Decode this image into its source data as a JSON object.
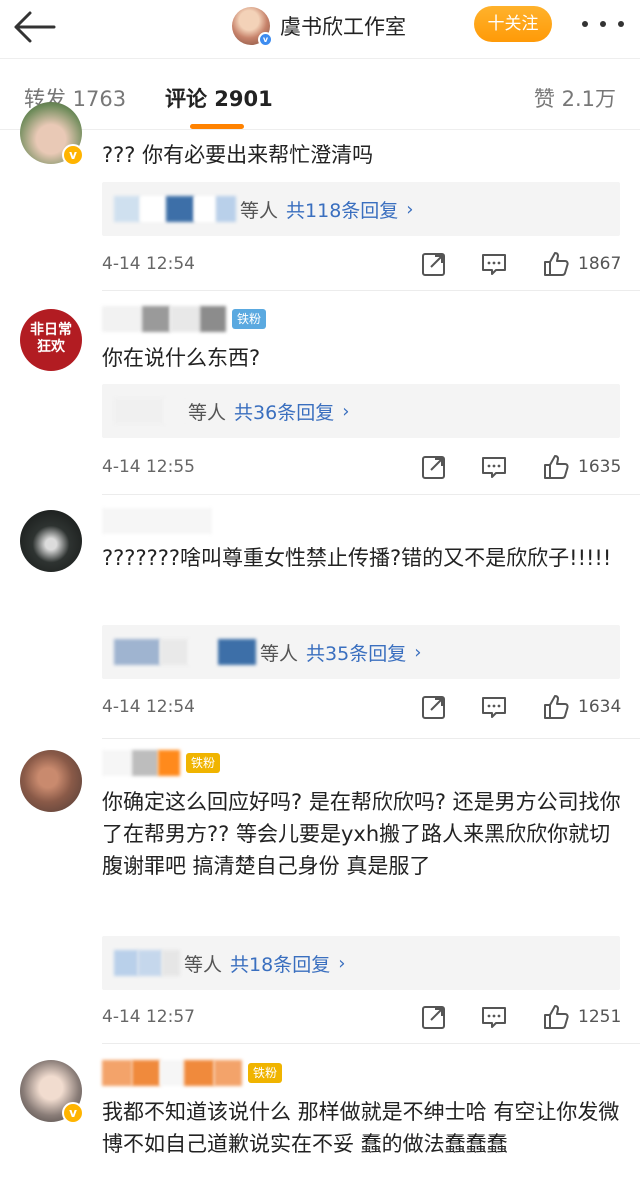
{
  "header": {
    "back_icon": "arrow-left-icon",
    "title": "虞书欣工作室",
    "follow_label": "十关注",
    "more_icon": "more-dots-icon",
    "accent": "#ff9a08"
  },
  "tabs": {
    "repost": "转发 1763",
    "comment": "评论 2901",
    "like": "赞 2.1万"
  },
  "comments": [
    {
      "text": "??? 你有必要出来帮忙澄清吗",
      "reply_who": "等人",
      "reply_count": "共118条回复",
      "chevron": "›",
      "time": "4-14 12:54",
      "likes": "1867"
    },
    {
      "badge": "铁粉",
      "avatar_text1": "非日常",
      "avatar_text2": "狂欢",
      "text": "你在说什么东西?",
      "reply_who": "等人",
      "reply_count": "共36条回复",
      "chevron": "›",
      "time": "4-14 12:55",
      "likes": "1635"
    },
    {
      "text": "???????啥叫尊重女性禁止传播?错的又不是欣欣子!!!!!",
      "reply_who": "等人",
      "reply_count": "共35条回复",
      "chevron": "›",
      "time": "4-14 12:54",
      "likes": "1634"
    },
    {
      "badge": "铁粉",
      "text": "你确定这么回应好吗? 是在帮欣欣吗? 还是男方公司找你了在帮男方?? 等会儿要是yxh搬了路人来黑欣欣你就切腹谢罪吧 搞清楚自己身份 真是服了",
      "reply_who": "等人",
      "reply_count": "共18条回复",
      "chevron": "›",
      "time": "4-14 12:57",
      "likes": "1251"
    },
    {
      "badge": "铁粉",
      "text": "我都不知道该说什么  那样做就是不绅士哈  有空让你发微博不如自己道歉说实在不妥 蠢的做法蠢蠢蠢"
    }
  ]
}
